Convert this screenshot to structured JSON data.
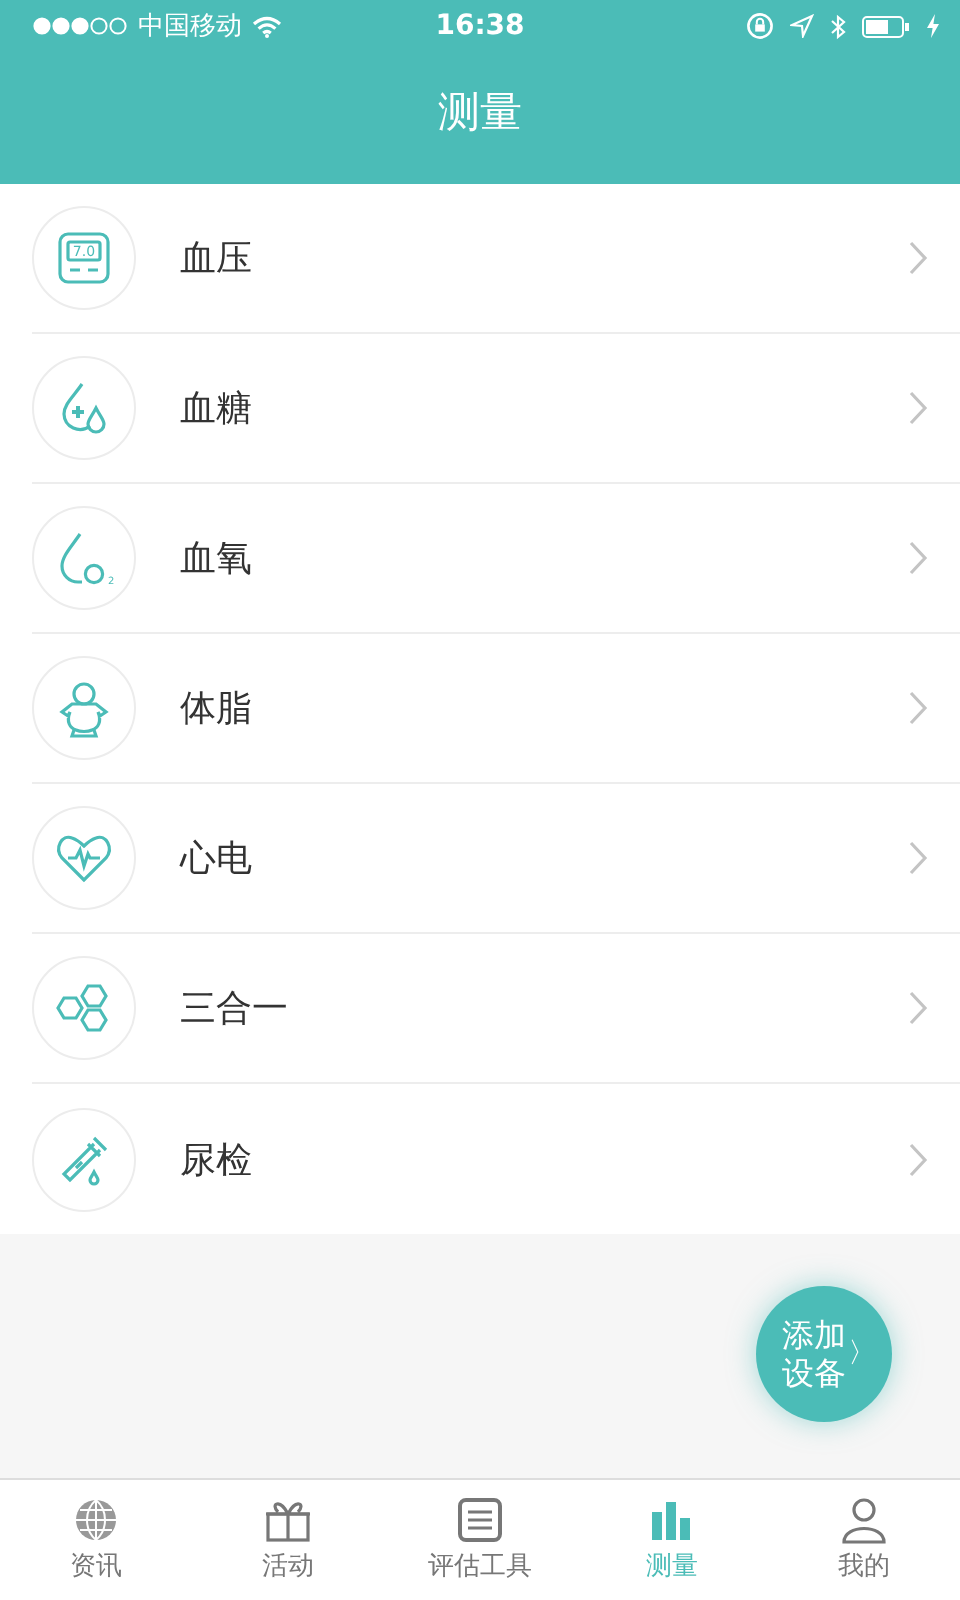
{
  "status_bar": {
    "carrier": "中国移动",
    "time": "16:38"
  },
  "header": {
    "title": "测量"
  },
  "items": [
    {
      "label": "血压",
      "icon_text": "7.0"
    },
    {
      "label": "血糖"
    },
    {
      "label": "血氧",
      "icon_text": "2"
    },
    {
      "label": "体脂"
    },
    {
      "label": "心电"
    },
    {
      "label": "三合一"
    },
    {
      "label": "尿检"
    }
  ],
  "fab": {
    "label": "添加设备",
    "arrow": "〉"
  },
  "tabs": [
    {
      "label": "资讯",
      "selected": false
    },
    {
      "label": "活动",
      "selected": false
    },
    {
      "label": "评估工具",
      "selected": false
    },
    {
      "label": "测量",
      "selected": true
    },
    {
      "label": "我的",
      "selected": false
    }
  ]
}
